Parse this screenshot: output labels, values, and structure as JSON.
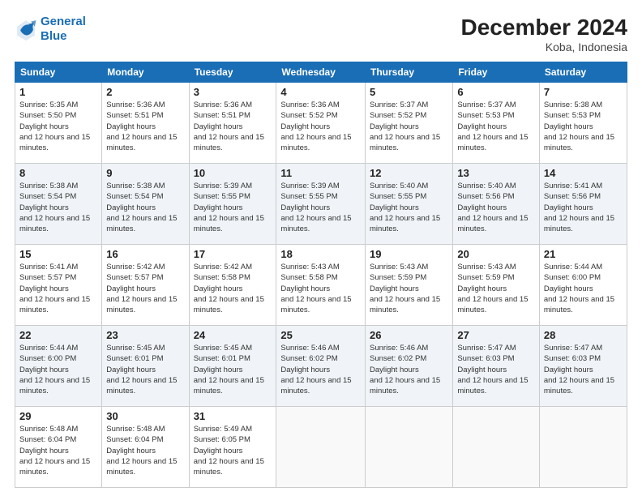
{
  "logo": {
    "line1": "General",
    "line2": "Blue"
  },
  "title": "December 2024",
  "location": "Koba, Indonesia",
  "weekdays": [
    "Sunday",
    "Monday",
    "Tuesday",
    "Wednesday",
    "Thursday",
    "Friday",
    "Saturday"
  ],
  "weeks": [
    [
      {
        "day": "1",
        "sunrise": "5:35 AM",
        "sunset": "5:50 PM",
        "daylight": "12 hours and 15 minutes."
      },
      {
        "day": "2",
        "sunrise": "5:36 AM",
        "sunset": "5:51 PM",
        "daylight": "12 hours and 15 minutes."
      },
      {
        "day": "3",
        "sunrise": "5:36 AM",
        "sunset": "5:51 PM",
        "daylight": "12 hours and 15 minutes."
      },
      {
        "day": "4",
        "sunrise": "5:36 AM",
        "sunset": "5:52 PM",
        "daylight": "12 hours and 15 minutes."
      },
      {
        "day": "5",
        "sunrise": "5:37 AM",
        "sunset": "5:52 PM",
        "daylight": "12 hours and 15 minutes."
      },
      {
        "day": "6",
        "sunrise": "5:37 AM",
        "sunset": "5:53 PM",
        "daylight": "12 hours and 15 minutes."
      },
      {
        "day": "7",
        "sunrise": "5:38 AM",
        "sunset": "5:53 PM",
        "daylight": "12 hours and 15 minutes."
      }
    ],
    [
      {
        "day": "8",
        "sunrise": "5:38 AM",
        "sunset": "5:54 PM",
        "daylight": "12 hours and 15 minutes."
      },
      {
        "day": "9",
        "sunrise": "5:38 AM",
        "sunset": "5:54 PM",
        "daylight": "12 hours and 15 minutes."
      },
      {
        "day": "10",
        "sunrise": "5:39 AM",
        "sunset": "5:55 PM",
        "daylight": "12 hours and 15 minutes."
      },
      {
        "day": "11",
        "sunrise": "5:39 AM",
        "sunset": "5:55 PM",
        "daylight": "12 hours and 15 minutes."
      },
      {
        "day": "12",
        "sunrise": "5:40 AM",
        "sunset": "5:55 PM",
        "daylight": "12 hours and 15 minutes."
      },
      {
        "day": "13",
        "sunrise": "5:40 AM",
        "sunset": "5:56 PM",
        "daylight": "12 hours and 15 minutes."
      },
      {
        "day": "14",
        "sunrise": "5:41 AM",
        "sunset": "5:56 PM",
        "daylight": "12 hours and 15 minutes."
      }
    ],
    [
      {
        "day": "15",
        "sunrise": "5:41 AM",
        "sunset": "5:57 PM",
        "daylight": "12 hours and 15 minutes."
      },
      {
        "day": "16",
        "sunrise": "5:42 AM",
        "sunset": "5:57 PM",
        "daylight": "12 hours and 15 minutes."
      },
      {
        "day": "17",
        "sunrise": "5:42 AM",
        "sunset": "5:58 PM",
        "daylight": "12 hours and 15 minutes."
      },
      {
        "day": "18",
        "sunrise": "5:43 AM",
        "sunset": "5:58 PM",
        "daylight": "12 hours and 15 minutes."
      },
      {
        "day": "19",
        "sunrise": "5:43 AM",
        "sunset": "5:59 PM",
        "daylight": "12 hours and 15 minutes."
      },
      {
        "day": "20",
        "sunrise": "5:43 AM",
        "sunset": "5:59 PM",
        "daylight": "12 hours and 15 minutes."
      },
      {
        "day": "21",
        "sunrise": "5:44 AM",
        "sunset": "6:00 PM",
        "daylight": "12 hours and 15 minutes."
      }
    ],
    [
      {
        "day": "22",
        "sunrise": "5:44 AM",
        "sunset": "6:00 PM",
        "daylight": "12 hours and 15 minutes."
      },
      {
        "day": "23",
        "sunrise": "5:45 AM",
        "sunset": "6:01 PM",
        "daylight": "12 hours and 15 minutes."
      },
      {
        "day": "24",
        "sunrise": "5:45 AM",
        "sunset": "6:01 PM",
        "daylight": "12 hours and 15 minutes."
      },
      {
        "day": "25",
        "sunrise": "5:46 AM",
        "sunset": "6:02 PM",
        "daylight": "12 hours and 15 minutes."
      },
      {
        "day": "26",
        "sunrise": "5:46 AM",
        "sunset": "6:02 PM",
        "daylight": "12 hours and 15 minutes."
      },
      {
        "day": "27",
        "sunrise": "5:47 AM",
        "sunset": "6:03 PM",
        "daylight": "12 hours and 15 minutes."
      },
      {
        "day": "28",
        "sunrise": "5:47 AM",
        "sunset": "6:03 PM",
        "daylight": "12 hours and 15 minutes."
      }
    ],
    [
      {
        "day": "29",
        "sunrise": "5:48 AM",
        "sunset": "6:04 PM",
        "daylight": "12 hours and 15 minutes."
      },
      {
        "day": "30",
        "sunrise": "5:48 AM",
        "sunset": "6:04 PM",
        "daylight": "12 hours and 15 minutes."
      },
      {
        "day": "31",
        "sunrise": "5:49 AM",
        "sunset": "6:05 PM",
        "daylight": "12 hours and 15 minutes."
      },
      null,
      null,
      null,
      null
    ]
  ],
  "cell_labels": {
    "sunrise": "Sunrise: ",
    "sunset": "Sunset: ",
    "daylight": "Daylight hours"
  }
}
